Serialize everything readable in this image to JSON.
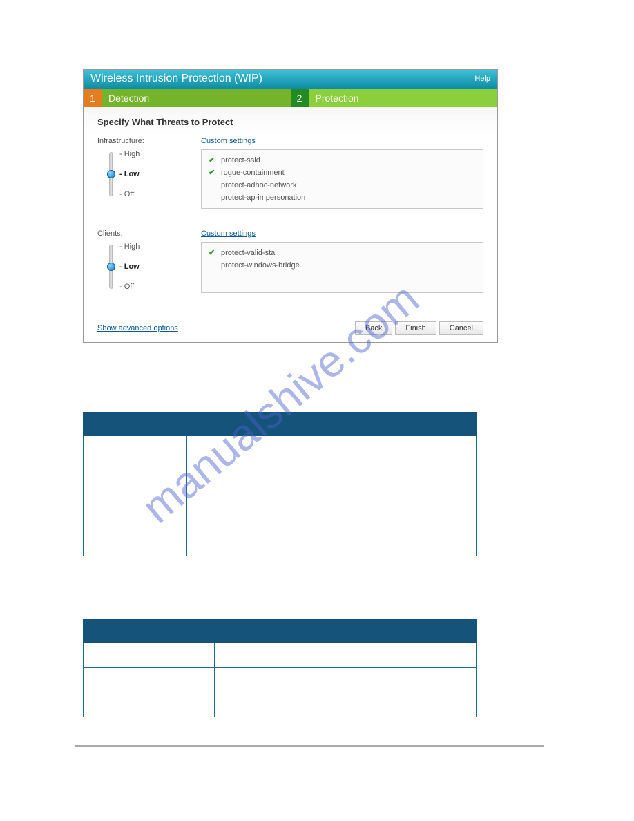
{
  "dialog": {
    "title": "Wireless Intrusion Protection (WIP)",
    "help": "Help",
    "tabs": [
      {
        "num": "1",
        "label": "Detection"
      },
      {
        "num": "2",
        "label": "Protection"
      }
    ],
    "section_title": "Specify What Threats to Protect",
    "infrastructure": {
      "label": "Infrastructure:",
      "slider": {
        "high": "- High",
        "low": "- Low",
        "off": "- Off",
        "selected": "low"
      },
      "custom_link": "Custom settings",
      "features": [
        {
          "checked": true,
          "name": "protect-ssid"
        },
        {
          "checked": true,
          "name": "rogue-containment"
        },
        {
          "checked": false,
          "name": "protect-adhoc-network"
        },
        {
          "checked": false,
          "name": "protect-ap-impersonation"
        }
      ]
    },
    "clients": {
      "label": "Clients:",
      "slider": {
        "high": "- High",
        "low": "- Low",
        "off": "- Off",
        "selected": "low"
      },
      "custom_link": "Custom settings",
      "features": [
        {
          "checked": true,
          "name": "protect-valid-sta"
        },
        {
          "checked": false,
          "name": "protect-windows-bridge"
        }
      ]
    },
    "advanced_link": "Show advanced options",
    "buttons": {
      "back": "Back",
      "finish": "Finish",
      "cancel": "Cancel"
    }
  },
  "watermark": "manualshive.com",
  "table1": {
    "header": [
      "",
      ""
    ],
    "rows": [
      [
        "",
        ""
      ],
      [
        "",
        ""
      ],
      [
        "",
        ""
      ]
    ]
  },
  "table2": {
    "header": [
      "",
      ""
    ],
    "rows": [
      [
        "",
        ""
      ],
      [
        "",
        ""
      ],
      [
        "",
        ""
      ]
    ]
  }
}
